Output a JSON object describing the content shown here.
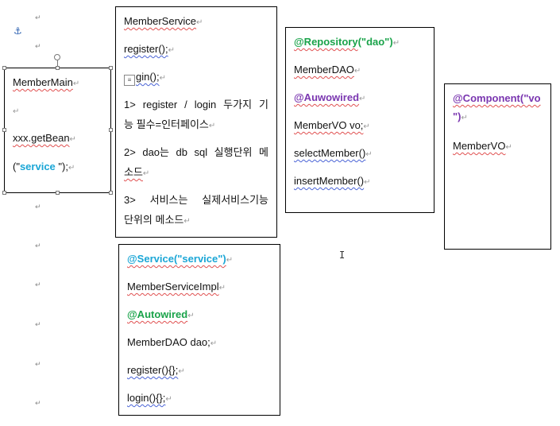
{
  "anchor_icon": "anchor-icon",
  "paragraph_mark": "↵",
  "main_box": {
    "title": "MemberMain",
    "call": "xxx.getBean",
    "arg_open": "(\"",
    "arg_value": "service",
    "arg_close": " \");"
  },
  "service_box": {
    "title": "MemberService",
    "method1": "register();",
    "method2": "gin();",
    "note1_line1": "1>  register  /  login  두가지  기",
    "note1_line2": "능 필수=인터페이스",
    "note2_line1": "2>  dao는  db  sql  실행단위  메",
    "note2_line2": "소드",
    "note3_line1": "3>    서비스는    실제서비스기능",
    "note3_line2": "단위의 메소드"
  },
  "impl_box": {
    "annotation": "@Service(\"service\")",
    "class_name": "MemberServiceImpl",
    "autowired": "@Autowired",
    "field": "MemberDAO dao;",
    "method1": "register(){};",
    "method2": "login(){};"
  },
  "dao_box": {
    "annotation_prefix": "@Repository",
    "annotation_arg": "(\"dao\")",
    "class_name": "MemberDAO",
    "autowired": "@Auwowired",
    "field": "MemberVO vo;",
    "method1": "selectMember()",
    "method2": "insertMember()"
  },
  "vo_box": {
    "annotation_line1": "@Component(\"vo",
    "annotation_line2": "\")",
    "class_name": "MemberVO"
  },
  "colors": {
    "green": "#1aa34a",
    "purple": "#7a36b0",
    "cyan": "#1aa6d6"
  }
}
